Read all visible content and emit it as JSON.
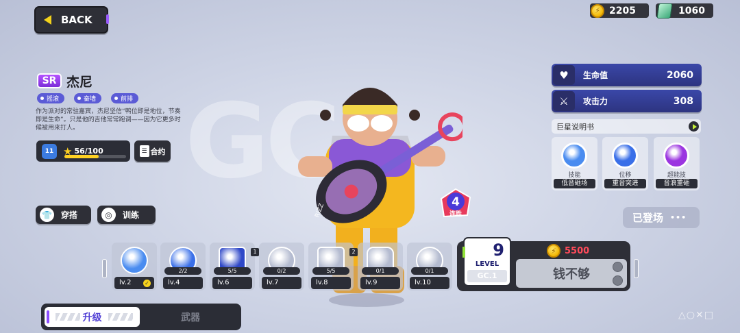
{
  "top": {
    "back_label": "BACK",
    "coins": "2205",
    "gems": "1060"
  },
  "hero": {
    "rarity": "SR",
    "name": "杰尼",
    "tags": [
      "摇滚",
      "奋墙",
      "前排"
    ],
    "description": "作为派对的常驻嘉宾，杰尼坚信“鸭位即是地位，节奏即是生命”。只是他的吉他常常跑调——因为它更多时候被用来打人。",
    "level_icon_text": "11",
    "xp_text": "56/100",
    "xp_fraction": 0.56,
    "contract_label": "合约",
    "outfit_label": "穿搭",
    "training_label": "训练"
  },
  "stats": [
    {
      "label": "生命值",
      "value": "2060",
      "icon": "heart-icon"
    },
    {
      "label": "攻击力",
      "value": "308",
      "icon": "sword-icon"
    }
  ],
  "giant_book_label": "巨星说明书",
  "skills": [
    {
      "kind": "技能",
      "name": "低音砸场",
      "color": "#4a8cf0"
    },
    {
      "kind": "位移",
      "name": "重音突进",
      "color": "#3a6fe8"
    },
    {
      "kind": "超能技",
      "name": "音浪重砸",
      "color": "#9b35e0"
    }
  ],
  "debut_label": "已登场",
  "streak": {
    "count": "4",
    "label": "连胜"
  },
  "upgrade_nodes": [
    {
      "level": "lv.2",
      "progress": "",
      "badge": "",
      "done": true,
      "color": "#4a8cf0"
    },
    {
      "level": "lv.4",
      "progress": "2/2",
      "badge": "",
      "done": false,
      "color": "#3a6fe8"
    },
    {
      "level": "lv.6",
      "progress": "5/5",
      "badge": "1",
      "done": false,
      "color": "#2f48c8"
    },
    {
      "level": "lv.7",
      "progress": "0/2",
      "badge": "",
      "done": false,
      "color": "#b4bbd0"
    },
    {
      "level": "lv.8",
      "progress": "5/5",
      "badge": "2",
      "done": false,
      "color": "#b4bbd0"
    },
    {
      "level": "lv.9",
      "progress": "0/1",
      "badge": "",
      "done": false,
      "color": "#b4bbd0"
    },
    {
      "level": "lv.10",
      "progress": "0/1",
      "badge": "",
      "done": false,
      "color": "#b4bbd0"
    }
  ],
  "level_card": {
    "number": "9",
    "word": "LEVEL",
    "logo": "GC.1"
  },
  "upgrade": {
    "cost": "5500",
    "button_label": "钱不够"
  },
  "tabs": {
    "upgrade": "升级",
    "weapon": "武器"
  },
  "colors": {
    "accent_purple": "#8c4dff",
    "stat_blue": "#3a47a8",
    "coin_gold": "#f2b705",
    "warn_red": "#ff4a5a"
  }
}
